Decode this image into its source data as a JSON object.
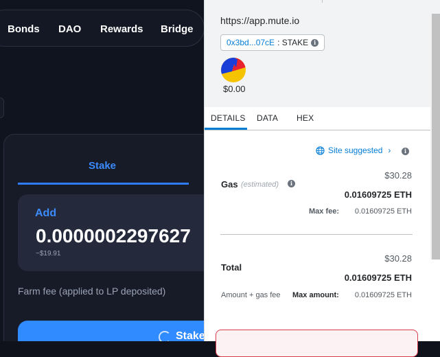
{
  "dapp": {
    "nav": {
      "bonds": "Bonds",
      "dao": "DAO",
      "rewards": "Rewards",
      "bridge": "Bridge"
    },
    "stake_tab": "Stake",
    "add_label": "Add",
    "amount": "0.0000002297627",
    "amount_usd": "~$19.91",
    "farm_fee": "Farm fee (applied to LP deposited)",
    "stake_button": "Stake"
  },
  "metamask": {
    "origin": "https://app.mute.io",
    "contract_address": "0x3bd...07cE",
    "method": ": STAKE",
    "fiat_balance": "$0.00",
    "tabs": {
      "details": "DETAILS",
      "data": "DATA",
      "hex": "HEX"
    },
    "site_suggested": "Site suggested",
    "gas": {
      "label": "Gas",
      "estimated": "(estimated)",
      "fiat": "$30.28",
      "eth": "0.01609725 ETH",
      "max_fee_label": "Max fee:",
      "max_fee_value": "0.01609725 ETH"
    },
    "total": {
      "label": "Total",
      "fiat": "$30.28",
      "eth": "0.01609725 ETH",
      "amount_gas_label": "Amount + gas fee",
      "max_amount_label": "Max amount:",
      "max_amount_value": "0.01609725 ETH"
    }
  },
  "colors": {
    "accent_blue": "#037dd6",
    "dapp_blue": "#2f8bff",
    "warning_red": "#d73a49"
  },
  "icons": [
    "info-icon",
    "globe-icon",
    "chevron-right-icon",
    "account-avatar-icon",
    "spinner-icon"
  ]
}
